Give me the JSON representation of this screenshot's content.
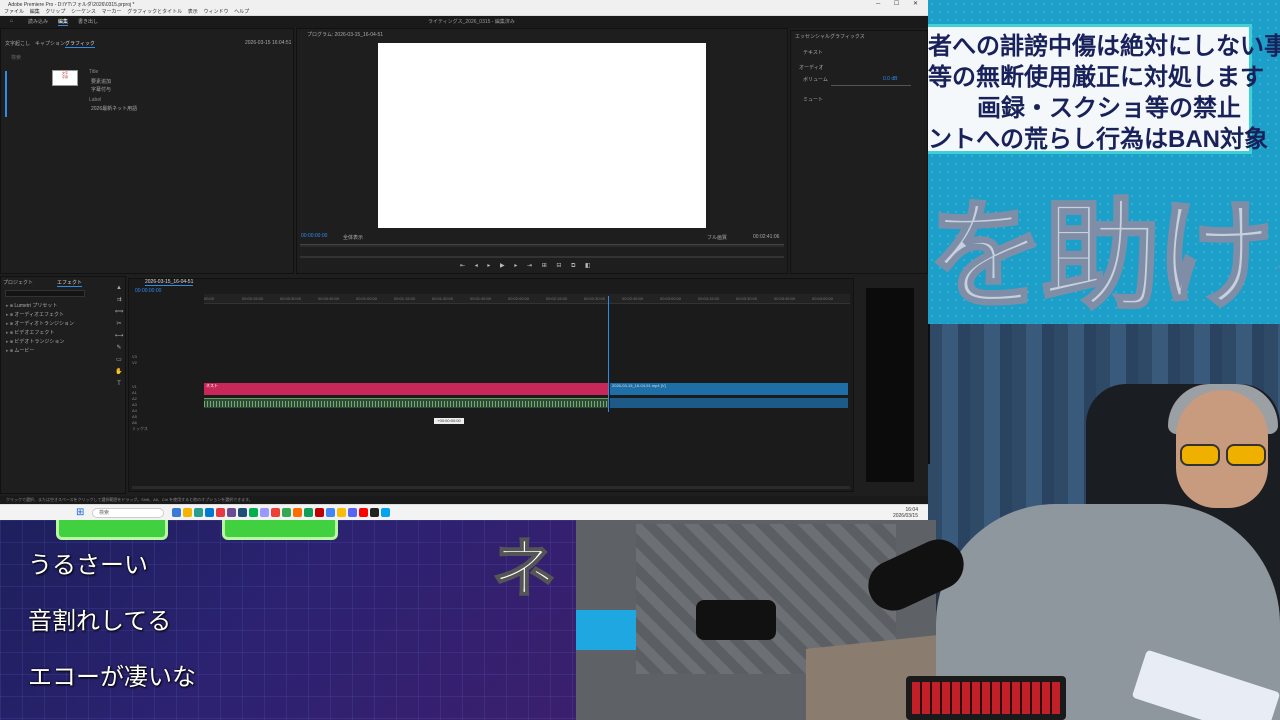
{
  "window": {
    "title": "Adobe Premiere Pro - D:\\YT\\フォルダ\\2026\\0315.prproj *",
    "project_title": "ライティングス_2026_0315 - 編集済み",
    "menus": [
      "ファイル",
      "編集",
      "クリップ",
      "シーケンス",
      "マーカー",
      "グラフィックとタイトル",
      "表示",
      "ウィンドウ",
      "ヘルプ"
    ],
    "workspaces": [
      "読み込み",
      "編集",
      "書き出し"
    ],
    "active_workspace": "編集"
  },
  "left_panel": {
    "tabs": [
      "文字起こし",
      "キャプション",
      "グラフィック"
    ],
    "active_tab": "グラフィック",
    "date": "2026-03-15 16:04:51",
    "search_placeholder": "検索",
    "item_title": "Title",
    "item_text_1": "要素追加",
    "item_text_2": "字幕付与",
    "item_label": "Label",
    "item_desc": "2026最新ネット用語"
  },
  "program": {
    "tab": "プログラム: 2026-03-15_16-04-51",
    "tc_in": "00:00:00:00",
    "fit": "全体表示",
    "quality": "フル画質",
    "tc_out": "00:02:41:06"
  },
  "essential": {
    "tab": "エッセンシャルグラフィックス",
    "name": "テキスト",
    "section": "オーディオ",
    "volume_label": "ボリューム",
    "volume_value": "0.0 dB",
    "check_label": "ミュート"
  },
  "project_panel": {
    "tabs": [
      "プロジェクト",
      "エフェクト"
    ],
    "search_placeholder": "",
    "items": [
      "Lumetri プリセット",
      "オーディオエフェクト",
      "オーディオトランジション",
      "ビデオエフェクト",
      "ビデオトランジション",
      "ムービー"
    ]
  },
  "timeline": {
    "tab": "2026-03-15_16-04-51",
    "timecode": "00:00:00:00",
    "ruler": [
      "00:00",
      "00:00:15:00",
      "00:00:30:00",
      "00:00:45:00",
      "00:01:00:00",
      "00:01:15:00",
      "00:01:30:00",
      "00:01:45:00",
      "00:02:00:00",
      "00:02:15:00",
      "00:02:30:00",
      "00:02:45:00",
      "00:03:00:00",
      "00:03:15:00",
      "00:03:30:00",
      "00:03:45:00",
      "00:04:00:00"
    ],
    "clip_pink_label": "ネスト",
    "clip_blue_label": "2026-03-15_16-04-51.mp4 [V]",
    "tooltip": "+00:00:00:00",
    "tracks": [
      "V3",
      "V2",
      "V1",
      "A1",
      "A2",
      "A3",
      "A4",
      "A5",
      "A6",
      "ミックス"
    ]
  },
  "status_text": "クリックで選択、または空きスペースをクリックして選択範囲をドラッグ。Shift、Alt、Ctrl を使用すると他のオプションを選択できます。",
  "taskbar": {
    "search": "検索",
    "time": "16:04",
    "date": "2026/03/15"
  },
  "banner": {
    "rules": [
      "者への誹謗中傷は絶対にしない事",
      "等の無断使用厳正に対処します",
      "画録・スクショ等の禁止",
      "ントへの荒らし行為はBAN対象"
    ],
    "big_text": "を助ける"
  },
  "comments": [
    "うるさーい",
    "音割れしてる",
    "エコーが凄いな"
  ],
  "overlay_char": "ネ"
}
